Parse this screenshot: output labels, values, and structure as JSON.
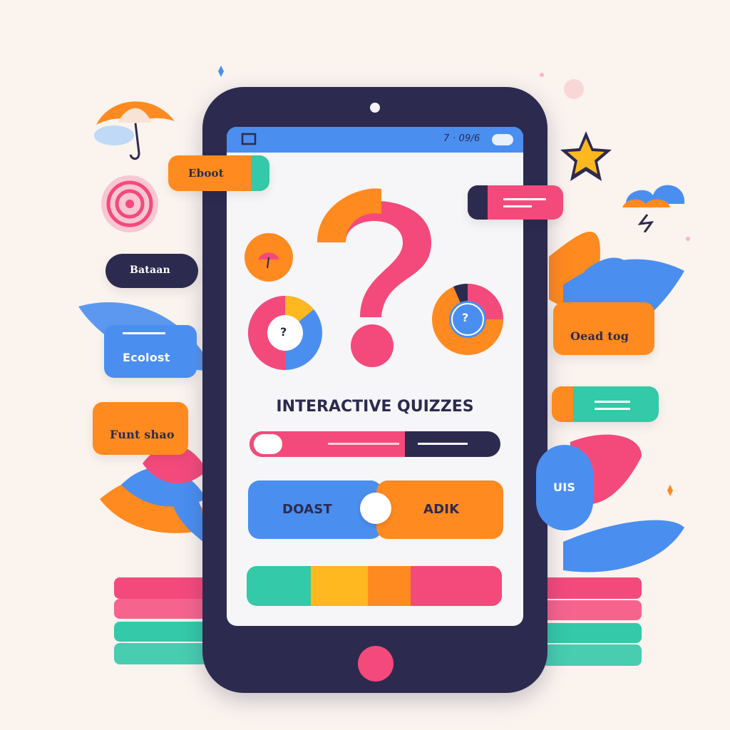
{
  "phone": {
    "status_text": "7 · 09/6",
    "title": "INTERACTIVE QUIZZES",
    "quiz_icon": "question-mark-icon",
    "answer_left": "DOAST",
    "answer_right": "ADIK",
    "question_glyph_left": "?",
    "question_glyph_right": "?"
  },
  "floating_labels": {
    "eboot": "Eboot",
    "batman": "Bataan",
    "ecolost": "Ecolost",
    "funt": "Funt shao",
    "oead": "Oead tog",
    "uis": "UIS"
  },
  "colors": {
    "background": "#faf3ee",
    "phone_body": "#2d2a4f",
    "blue": "#4a8ef0",
    "orange": "#ff8a1f",
    "pink": "#f44a7b",
    "teal": "#34c9a8"
  },
  "progress": {
    "slider_fraction": 0.6
  }
}
